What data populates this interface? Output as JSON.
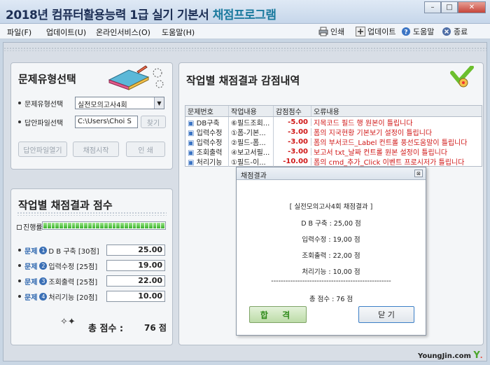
{
  "window": {
    "title_main": "2018년 컴퓨터활용능력 1급 실기 기본서",
    "title_accent": "채점프로그램",
    "min_glyph": "–",
    "max_glyph": "□",
    "close_glyph": "✕"
  },
  "menu": [
    {
      "label": "파일(F)"
    },
    {
      "label": "업데이트(U)"
    },
    {
      "label": "온라인서비스(O)"
    },
    {
      "label": "도움말(H)"
    }
  ],
  "toolbar": {
    "print": "인쇄",
    "update": "업데이트",
    "help": "도움말",
    "exit": "종료"
  },
  "select_panel": {
    "title": "문제유형선택",
    "type_label": "문제유형선택",
    "type_value": "실전모의고사4회",
    "file_label": "답안파일선택",
    "file_value": "C:\\Users\\Choi S",
    "browse": "찾기",
    "btn_open": "답안파일열기",
    "btn_start": "채점시작",
    "btn_print": "인 쇄"
  },
  "score_panel": {
    "title": "작업별 채점결과 점수",
    "progress_label": "진행률",
    "progress_fraction": 1.0,
    "prefix": "문제",
    "items": [
      {
        "num": "1",
        "label": "D B 구축 [30점]",
        "score": "25.00"
      },
      {
        "num": "2",
        "label": "입력수정 [25점]",
        "score": "19.00"
      },
      {
        "num": "3",
        "label": "조회출력 [25점]",
        "score": "22.00"
      },
      {
        "num": "4",
        "label": "처리기능 [20점]",
        "score": "10.00"
      }
    ],
    "total_label": "총 점수 :",
    "total_value": "76 점"
  },
  "deduction_panel": {
    "title": "작업별 채점결과 감점내역",
    "headers": [
      "문제번호",
      "작업내용",
      "감점점수",
      "오류내용"
    ],
    "rows": [
      {
        "no": "DB구축",
        "task": "⑥필드조회...",
        "points": "-5.00",
        "error": "지목코드 필드 행 원본이 틀립니다"
      },
      {
        "no": "입력수정",
        "task": "①폼-기본...",
        "points": "-3.00",
        "error": "폼의 지국현황 기본보기 설정이 틀립니다"
      },
      {
        "no": "입력수정",
        "task": "②필드-폼...",
        "points": "-3.00",
        "error": "폼의 부서코드_Label 컨트롤 풍선도움말이 틀립니다"
      },
      {
        "no": "조회출력",
        "task": "④보고서필...",
        "points": "-3.00",
        "error": "보고서 txt_날짜 컨트롤 원본 설정이 틀립니다"
      },
      {
        "no": "처리기능",
        "task": "①필드-이...",
        "points": "-10.00",
        "error": "폼의 cmd_추가_Click 이벤트 프로시저가 틀립니다"
      }
    ]
  },
  "dialog": {
    "title": "채점결과",
    "close_glyph": "⊠",
    "heading": "[ 실전모의고사4회 채점결과 ]",
    "lines": [
      "D B 구축 : 25,00 점",
      "입력수정 : 19,00 점",
      "조회출력 : 22,00 점",
      "처리기능 : 10,00 점"
    ],
    "separator": "--------------------------------------------------",
    "total": "총 점수 : 76 점",
    "pass_label": "합 격",
    "close_label": "닫 기"
  },
  "brand": "YoungJin.com",
  "colors": {
    "accent": "#1b7a9e",
    "error": "#d01818",
    "pass": "#2f8a1a"
  }
}
